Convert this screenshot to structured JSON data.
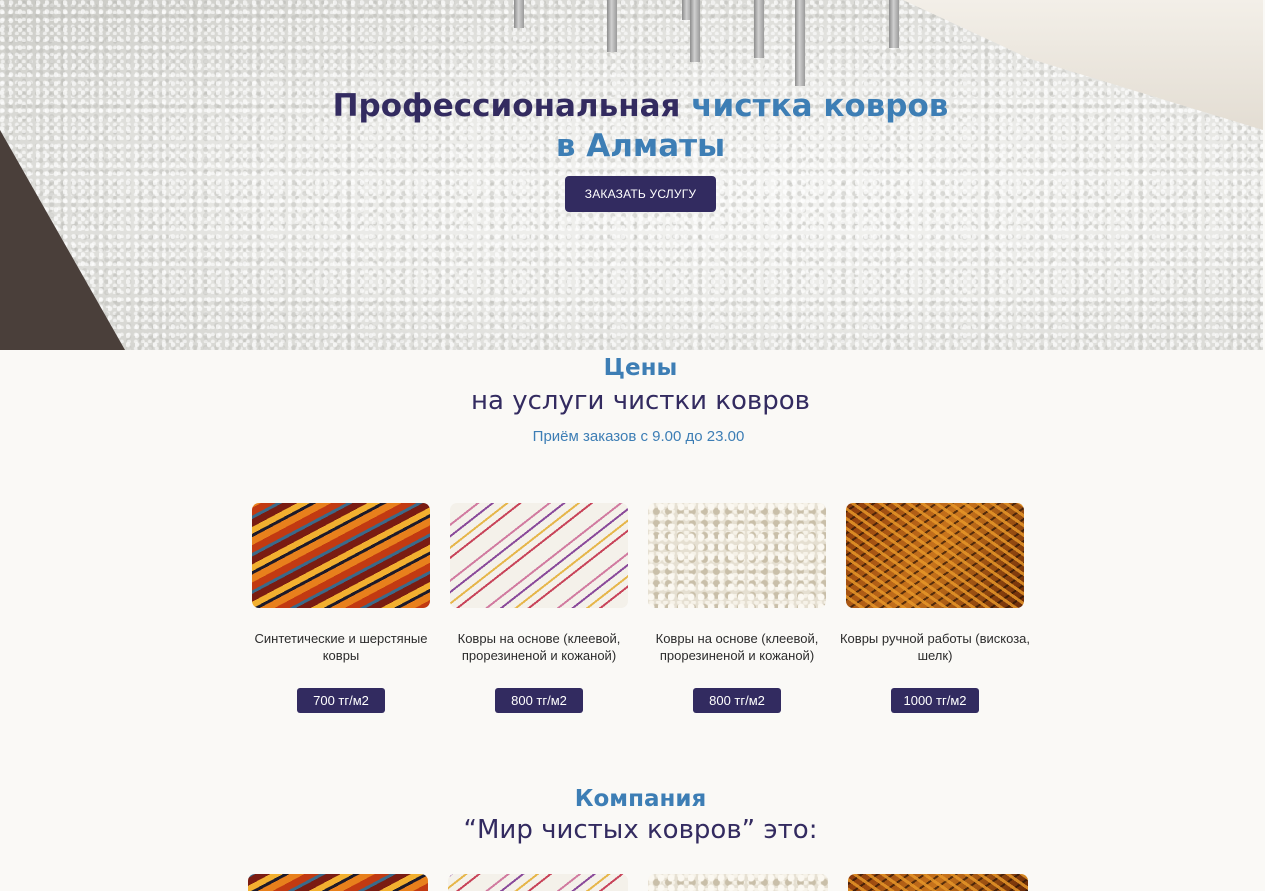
{
  "hero": {
    "title_dark": "Профессиональная",
    "title_light_1": "чистка ковров",
    "title_light_2": "в Алматы",
    "cta_label": "ЗАКАЗАТЬ УСЛУГУ"
  },
  "prices": {
    "title_accent": "Цены",
    "title_main": "на услуги чистки ковров",
    "hours": "Приём заказов с 9.00 до 23.00",
    "cards": [
      {
        "name": "Синтетические и шерстяные ковры",
        "price": "700 тг/м2",
        "image": "striped-kilim-carpet"
      },
      {
        "name": "Ковры на основе (клеевой, прорезиненой и кожаной)",
        "price": "800 тг/м2",
        "image": "white-striped-carpet"
      },
      {
        "name": "Ковры на основе (клеевой, прорезиненой и кожаной)",
        "price": "800 тг/м2",
        "image": "white-shaggy-carpet"
      },
      {
        "name": "Ковры ручной работы (вискоза, шелк)",
        "price": "1000 тг/м2",
        "image": "gold-silk-carpet"
      }
    ]
  },
  "company": {
    "title_accent": "Компания",
    "title_main": "“Мир чистых ковров” это:"
  },
  "colors": {
    "primary": "#322b60",
    "accent": "#3d7eb5",
    "background": "#faf9f6"
  }
}
